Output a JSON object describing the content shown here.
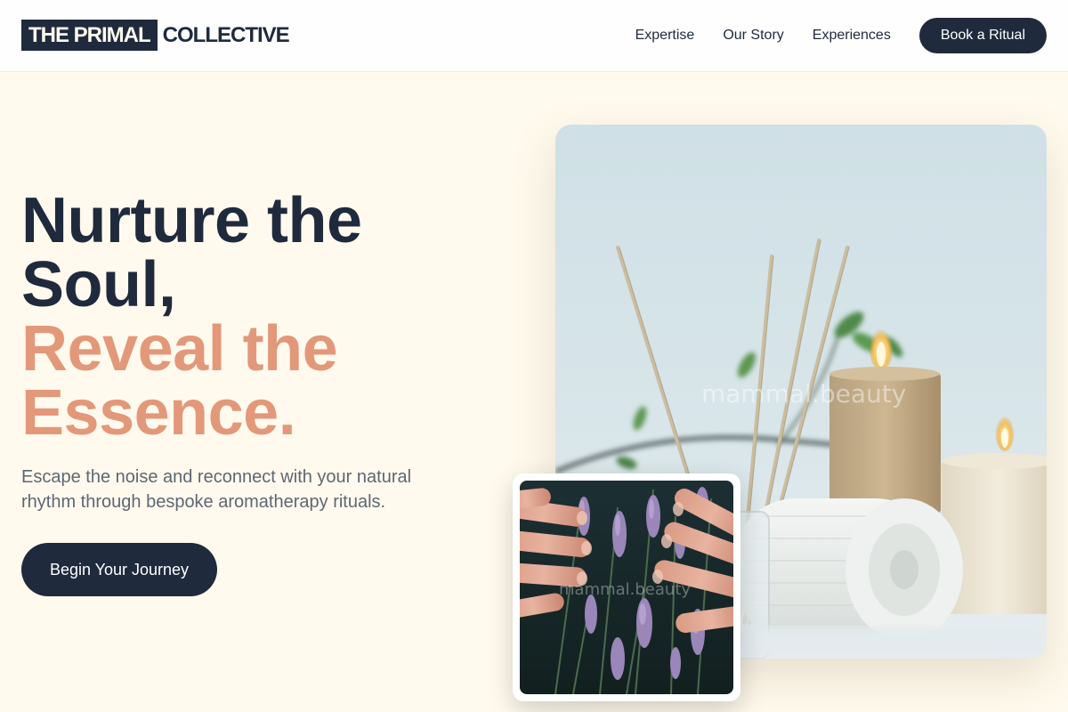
{
  "header": {
    "logo_highlight": "THE PRIMAL",
    "logo_rest": "COLLECTIVE",
    "nav": [
      "Expertise",
      "Our Story",
      "Experiences"
    ],
    "cta_label": "Book a Ritual"
  },
  "hero": {
    "title_line1": "Nurture the",
    "title_line2": "Soul,",
    "title_accent_line1": "Reveal the",
    "title_accent_line2": "Essence.",
    "subtitle": "Escape the noise and reconnect with your natural rhythm through bespoke aromatherapy rituals.",
    "cta_label": "Begin Your Journey"
  },
  "images": {
    "main_watermark": "mammal.beauty",
    "small_watermark": "mammal.beauty"
  },
  "colors": {
    "background": "#fffaed",
    "navy": "#1f2a3d",
    "accent": "#e3987a",
    "body_text": "#5f6675"
  },
  "icons": {
    "main_image": "candles-reed-diffuser-towel-photo",
    "small_image": "hands-lavender-photo"
  }
}
